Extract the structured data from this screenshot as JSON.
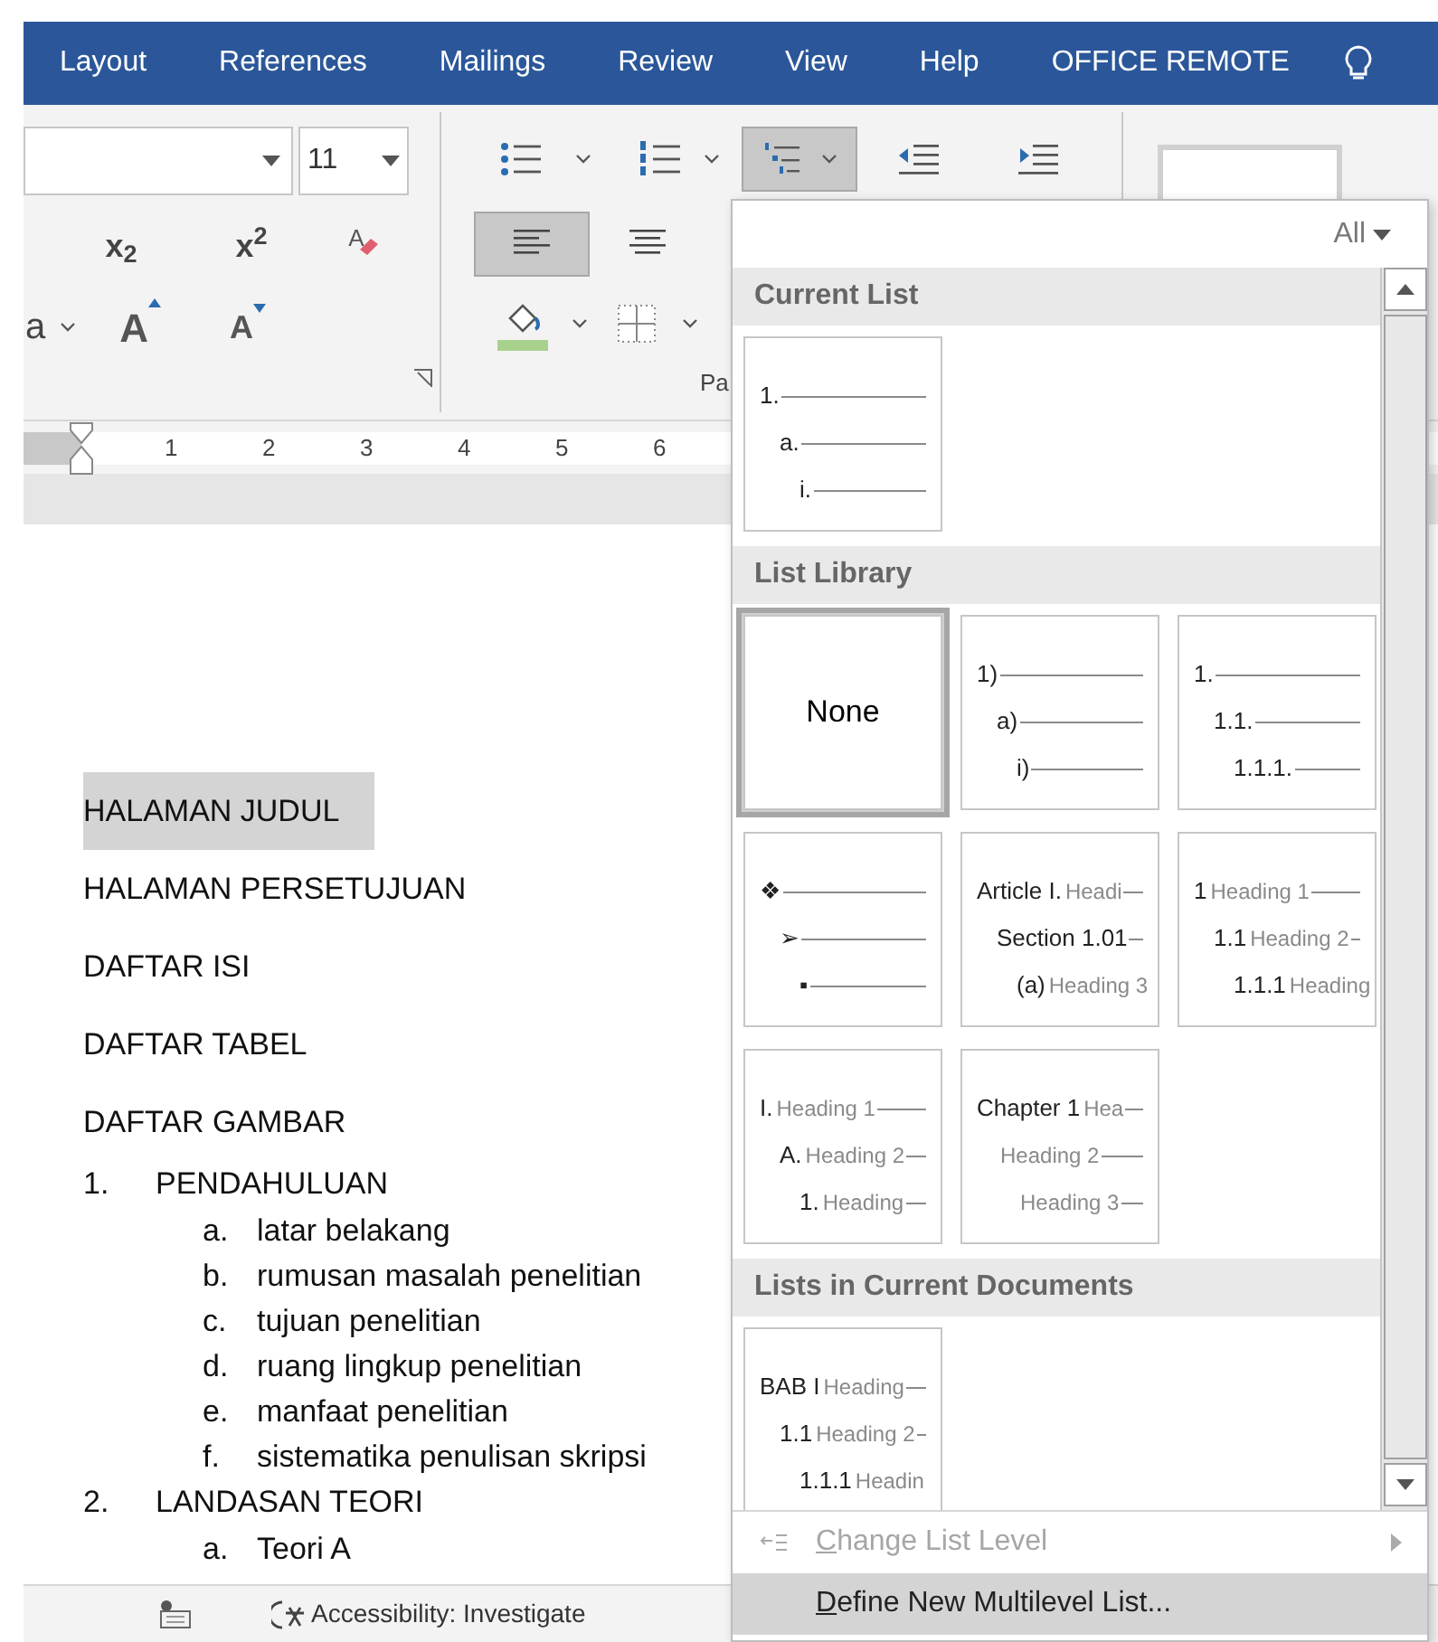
{
  "menu_tabs": [
    {
      "label": "Layout"
    },
    {
      "label": "References"
    },
    {
      "label": "Mailings"
    },
    {
      "label": "Review"
    },
    {
      "label": "View"
    },
    {
      "label": "Help"
    },
    {
      "label": "OFFICE REMOTE"
    }
  ],
  "font_group": {
    "font_size": "11",
    "subscript": "x$_{2}$",
    "superscript": "x$^{2}$",
    "clear_formatting": "A",
    "change_case": "a",
    "grow_font": "A",
    "shrink_font": "A"
  },
  "paragraph_group": {
    "label": "Pa",
    "multilevel_button": {
      "selected": true
    },
    "align_left_button": {
      "selected": true
    },
    "align_center_button": {
      "selected": false
    }
  },
  "ruler": {
    "numbers": [
      "1",
      "2",
      "3",
      "4",
      "5",
      "6"
    ]
  },
  "document": {
    "paragraphs": [
      {
        "text": "HALAMAN JUDUL",
        "selected": true
      },
      {
        "text": "HALAMAN PERSETUJUAN",
        "selected": false
      },
      {
        "text": "DAFTAR ISI",
        "selected": false
      },
      {
        "text": "DAFTAR TABEL",
        "selected": false
      },
      {
        "text": "DAFTAR GAMBAR",
        "selected": false
      }
    ],
    "list": [
      {
        "marker": "1.",
        "text": "PENDAHULUAN",
        "children": [
          {
            "marker": "a.",
            "text": "latar belakang"
          },
          {
            "marker": "b.",
            "text": "rumusan masalah penelitian"
          },
          {
            "marker": "c.",
            "text": "tujuan penelitian"
          },
          {
            "marker": "d.",
            "text": "ruang lingkup penelitian"
          },
          {
            "marker": "e.",
            "text": "manfaat penelitian"
          },
          {
            "marker": "f.",
            "text": "sistematika penulisan skripsi"
          }
        ]
      },
      {
        "marker": "2.",
        "text": "LANDASAN TEORI",
        "children": [
          {
            "marker": "a.",
            "text": "Teori A"
          }
        ]
      }
    ]
  },
  "status_bar": {
    "accessibility": "Accessibility: Investigate"
  },
  "multilevel_menu": {
    "filter": "All",
    "sections": [
      {
        "title": "Current List",
        "items": [
          {
            "kind": "levels",
            "selected": false,
            "level": {
              "marker": "1.",
              "children": [
                {
                  "marker": "a.",
                  "children": [
                    {
                      "marker": "i."
                    }
                  ]
                }
              ]
            }
          }
        ]
      },
      {
        "title": "List Library",
        "items": [
          {
            "kind": "none",
            "selected": true,
            "label": "None"
          },
          {
            "kind": "levels",
            "selected": false,
            "level": {
              "marker": "1)",
              "children": [
                {
                  "marker": "a)",
                  "children": [
                    {
                      "marker": "i)"
                    }
                  ]
                }
              ]
            }
          },
          {
            "kind": "levels",
            "selected": false,
            "level": {
              "marker": "1.",
              "children": [
                {
                  "marker": "1.1.",
                  "children": [
                    {
                      "marker": "1.1.1."
                    }
                  ]
                }
              ]
            }
          },
          {
            "kind": "levels",
            "selected": false,
            "level": {
              "marker": "❖",
              "children": [
                {
                  "marker": "➢",
                  "children": [
                    {
                      "marker": "▪"
                    }
                  ]
                }
              ]
            }
          },
          {
            "kind": "levels",
            "selected": false,
            "level": {
              "marker": "Article I.",
              "heading": "Headi",
              "children": [
                {
                  "marker": "Section 1.01",
                  "children": [
                    {
                      "marker": "(a)",
                      "heading": "Heading 3"
                    }
                  ]
                }
              ]
            }
          },
          {
            "kind": "levels",
            "selected": false,
            "level": {
              "marker": "1",
              "heading": "Heading 1",
              "children": [
                {
                  "marker": "1.1",
                  "heading": "Heading 2",
                  "children": [
                    {
                      "marker": "1.1.1",
                      "heading": "Heading"
                    }
                  ]
                }
              ]
            }
          },
          {
            "kind": "levels",
            "selected": false,
            "level": {
              "marker": "I.",
              "heading": "Heading 1",
              "children": [
                {
                  "marker": "A.",
                  "heading": "Heading 2",
                  "children": [
                    {
                      "marker": "1.",
                      "heading": "Heading"
                    }
                  ]
                }
              ]
            }
          },
          {
            "kind": "levels",
            "selected": false,
            "level": {
              "marker": "Chapter 1",
              "heading": "Hea",
              "children": [
                {
                  "heading": "Heading 2",
                  "children": [
                    {
                      "heading": "Heading 3"
                    }
                  ]
                }
              ]
            }
          }
        ]
      },
      {
        "title": "Lists in Current Documents",
        "items": [
          {
            "kind": "levels",
            "selected": false,
            "level": {
              "marker": "BAB I",
              "heading": "Heading",
              "children": [
                {
                  "marker": "1.1",
                  "heading": "Heading 2",
                  "children": [
                    {
                      "marker": "1.1.1",
                      "heading": "Headin"
                    }
                  ]
                }
              ]
            }
          }
        ]
      }
    ],
    "commands": [
      {
        "label": "Change List Level",
        "disabled": true,
        "submenu": true,
        "selected": false
      },
      {
        "label": "Define New Multilevel List...",
        "disabled": false,
        "submenu": false,
        "selected": true
      }
    ]
  }
}
